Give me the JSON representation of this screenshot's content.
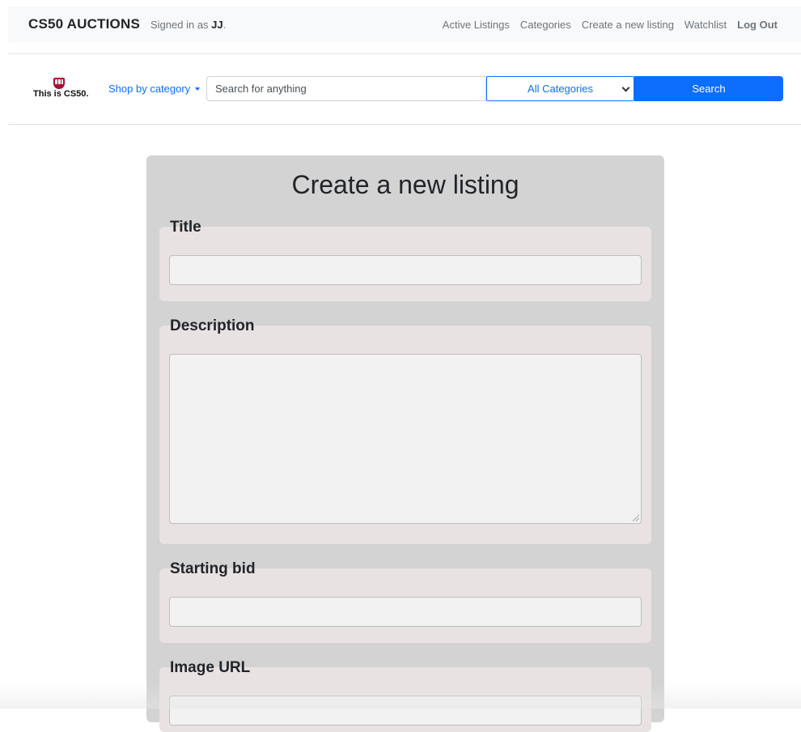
{
  "navbar": {
    "brand": "CS50 AUCTIONS",
    "signed_in_prefix": "Signed in as ",
    "username": "JJ",
    "signed_in_suffix": ".",
    "links": [
      "Active Listings",
      "Categories",
      "Create a new listing",
      "Watchlist",
      "Log Out"
    ]
  },
  "search_bar": {
    "logo_text": "This is CS50.",
    "shop_by_category": "Shop by category",
    "search_placeholder": "Search for anything",
    "category_selected": "All Categories",
    "search_button": "Search"
  },
  "form": {
    "title": "Create a new listing",
    "fields": [
      {
        "label": "Title",
        "value": ""
      },
      {
        "label": "Description",
        "value": ""
      },
      {
        "label": "Starting bid",
        "value": ""
      },
      {
        "label": "Image URL",
        "value": ""
      }
    ]
  },
  "colors": {
    "accent": "#0d6efd",
    "panel": "#d3d3d3",
    "field_box": "#e8e2e2"
  }
}
